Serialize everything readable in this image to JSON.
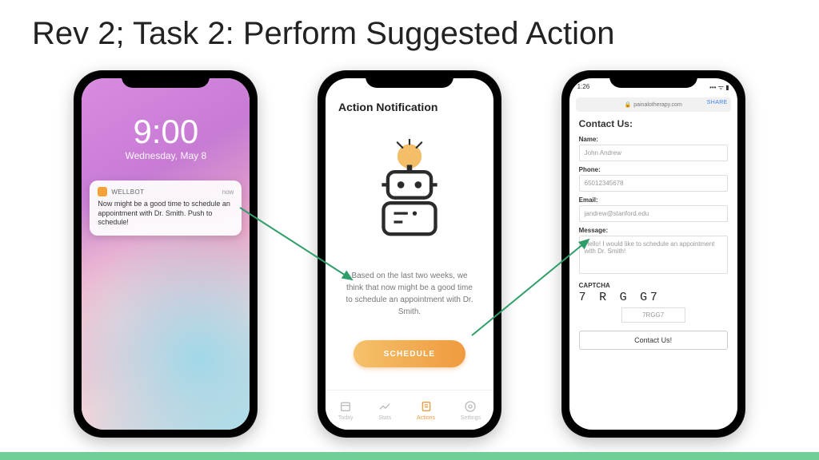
{
  "title": "Rev 2; Task 2: Perform Suggested Action",
  "phone1": {
    "time": "9:00",
    "date": "Wednesday, May 8",
    "push": {
      "app": "WELLBOT",
      "when": "now",
      "body": "Now might be a good time to schedule an appointment with Dr. Smith. Push to schedule!"
    }
  },
  "phone2": {
    "header": "Action Notification",
    "message": "Based on the last two weeks, we think that now might be a good time to schedule an appointment with Dr. Smith.",
    "button": "SCHEDULE",
    "nav": [
      "Today",
      "Stats",
      "Actions",
      "Settings"
    ]
  },
  "phone3": {
    "time": "1:26",
    "url": "painalotherapy.com",
    "share": "SHARE",
    "title": "Contact Us:",
    "name_label": "Name:",
    "name_value": "John Andrew",
    "phone_label": "Phone:",
    "phone_value": "65012345678",
    "email_label": "Email:",
    "email_value": "jandrew@stanford.edu",
    "message_label": "Message:",
    "message_value": "Hello! I would like to schedule an appointment with Dr. Smith!",
    "captcha_label": "CAPTCHA",
    "captcha_image": "7 R G G7",
    "captcha_value": "7RGG7",
    "submit": "Contact Us!"
  }
}
